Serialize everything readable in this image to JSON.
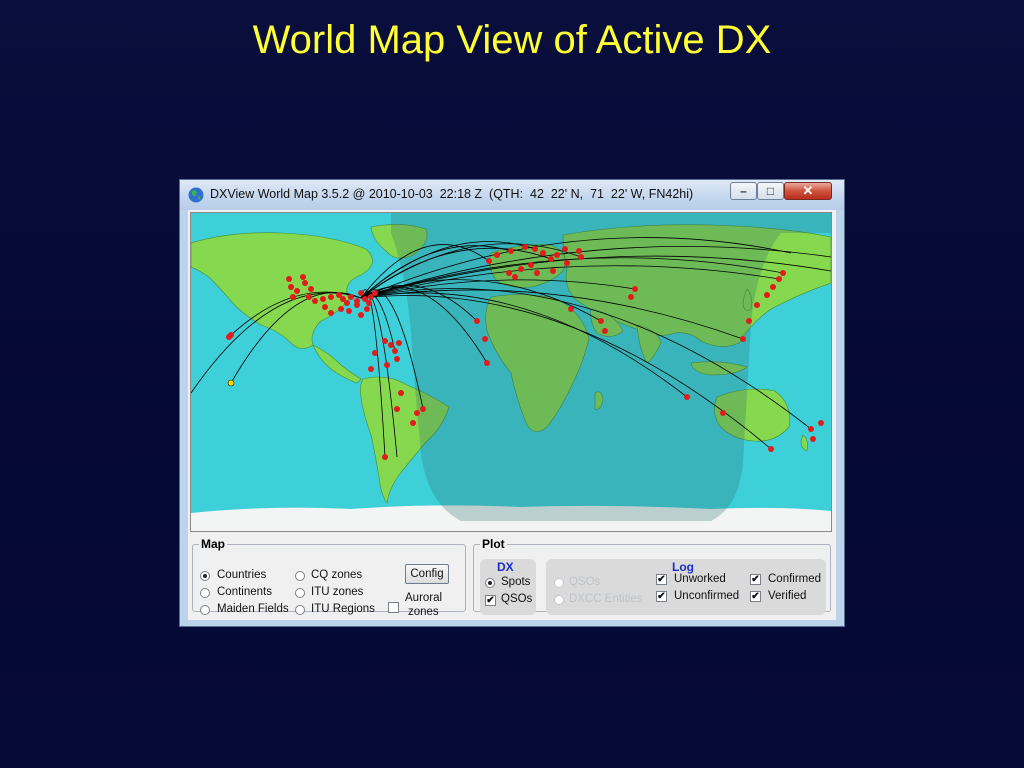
{
  "slide": {
    "title": "World Map View of Active DX"
  },
  "window": {
    "title": "DXView World Map 3.5.2 @ 2010-10-03  22:18 Z  (QTH:  42  22' N,  71  22' W, FN42hi)",
    "icon": "globe-icon",
    "buttons": {
      "minimize": "minimize-icon",
      "maximize": "maximize-icon",
      "close": "close-icon"
    }
  },
  "map_group": {
    "legend": "Map",
    "options": [
      {
        "label": "Countries",
        "selected": true
      },
      {
        "label": "Continents",
        "selected": false
      },
      {
        "label": "Maiden Fields",
        "selected": false
      },
      {
        "label": "CQ zones",
        "selected": false
      },
      {
        "label": "ITU zones",
        "selected": false
      },
      {
        "label": "ITU Regions",
        "selected": false
      }
    ],
    "config_button": "Config",
    "auroral": {
      "label_line1": "Auroral",
      "label_line2": "zones",
      "checked": false
    }
  },
  "plot_group": {
    "legend": "Plot",
    "dx": {
      "header": "DX",
      "options": [
        {
          "label": "Spots",
          "type": "radio",
          "checked": true
        },
        {
          "label": "QSOs",
          "type": "checkbox",
          "checked": true
        }
      ]
    },
    "log": {
      "header": "Log",
      "disabled_options": [
        {
          "label": "QSOs",
          "enabled": false
        },
        {
          "label": "DXCC Entities",
          "enabled": false
        }
      ],
      "options": [
        {
          "label": "Unworked",
          "checked": true
        },
        {
          "label": "Unconfirmed",
          "checked": true
        },
        {
          "label": "Confirmed",
          "checked": true
        },
        {
          "label": "Verified",
          "checked": true
        }
      ]
    }
  },
  "colors": {
    "slide_title": "#ffff33",
    "ocean": "#3dd0d8",
    "land": "#86d94e",
    "night_shade": "#5a9aa0",
    "spot_dot": "#e21b1b",
    "path_line": "#000000",
    "close_button": "#c8412d"
  }
}
